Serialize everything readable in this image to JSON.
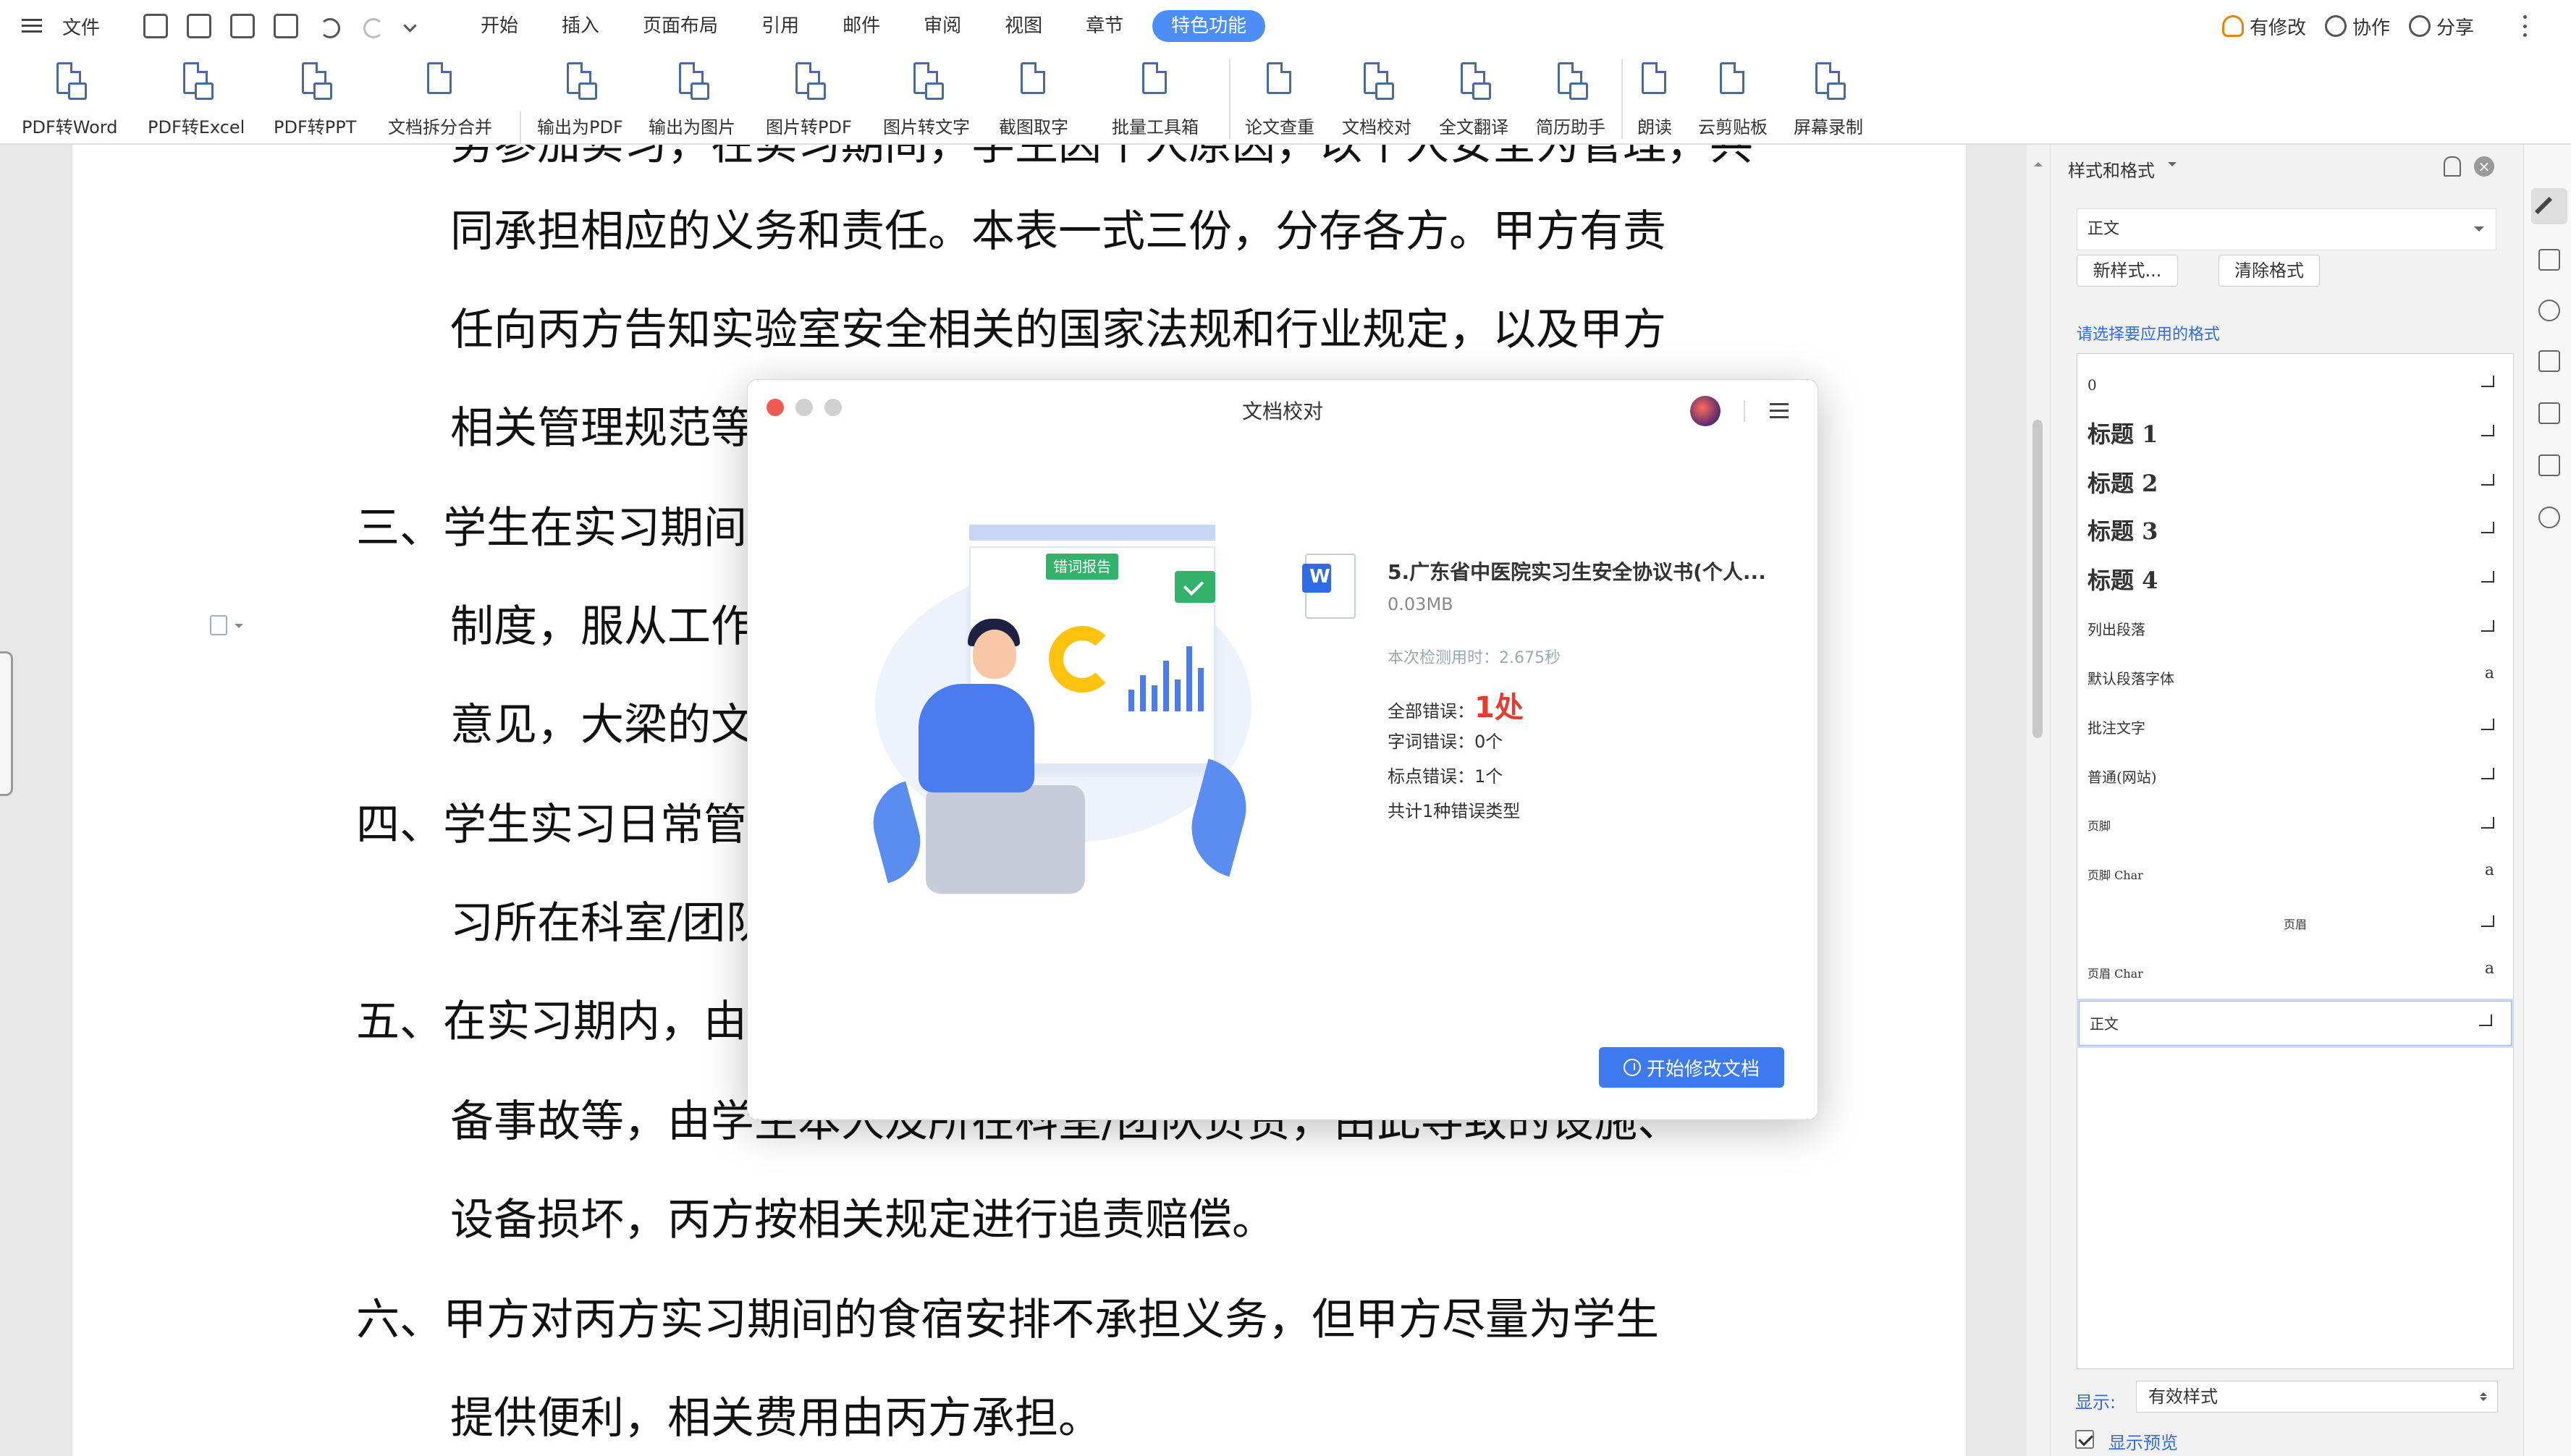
{
  "menubar": {
    "file": "文件",
    "tabs": [
      "开始",
      "插入",
      "页面布局",
      "引用",
      "邮件",
      "审阅",
      "视图",
      "章节"
    ],
    "active_tab": "特色功能",
    "right": {
      "revise": "有修改",
      "collab": "协作",
      "share": "分享"
    }
  },
  "ribbon": {
    "buttons": [
      "PDF转Word",
      "PDF转Excel",
      "PDF转PPT",
      "文档拆分合并",
      "输出为PDF",
      "输出为图片",
      "图片转PDF",
      "图片转文字",
      "截图取字",
      "批量工具箱",
      "论文查重",
      "文档校对",
      "全文翻译",
      "简历助手",
      "朗读",
      "云剪贴板",
      "屏幕录制"
    ]
  },
  "document": {
    "lines": [
      "同承担相应的义务和责任。本表一式三份，分存各方。甲方有责",
      "任向丙方告知实验室安全相关的国家法规和行业规定，以及甲方",
      "相关管理规范等",
      "三、学生在实习期间",
      "制度，服从工作",
      "意见，大梁的文",
      "四、学生实习日常管",
      "习所在科室/团队",
      "五、在实习期内，由",
      "备事故等，由学生本人及所在科室/团队负责，由此导致的设施、",
      "设备损坏，丙方按相关规定进行追责赔偿。",
      "六、甲方对丙方实习期间的食宿安排不承担义务，但甲方尽量为学生",
      "提供便利，相关费用由丙方承担。"
    ]
  },
  "dialog": {
    "title": "文档校对",
    "illustration_tag": "错词报告",
    "file_name": "5.广东省中医院实习生安全协议书(个人...",
    "file_size": "0.03MB",
    "check_time": "本次检测用时：2.675秒",
    "total_label": "全部错误：",
    "total_value": "1处",
    "word_errors": "字词错误：0个",
    "punct_errors": "标点错误：1个",
    "summary": "共计1种错误类型",
    "start_button": "开始修改文档"
  },
  "stylepanel": {
    "title": "样式和格式",
    "current_style": "正文",
    "new_style": "新样式...",
    "clear_format": "清除格式",
    "hint": "请选择要应用的格式",
    "items": [
      "0",
      "标题 1",
      "标题 2",
      "标题 3",
      "标题 4",
      "列出段落",
      "默认段落字体",
      "批注文字",
      "普通(网站)",
      "页脚",
      "页脚 Char",
      "页眉",
      "页眉 Char",
      "正文"
    ],
    "show_label": "显示:",
    "show_value": "有效样式",
    "preview_label": "显示预览"
  },
  "colors": {
    "accent": "#4c8df6",
    "error_red": "#e83a2e",
    "illustration_green": "#33b26b",
    "hint_blue": "#2f6be6"
  }
}
